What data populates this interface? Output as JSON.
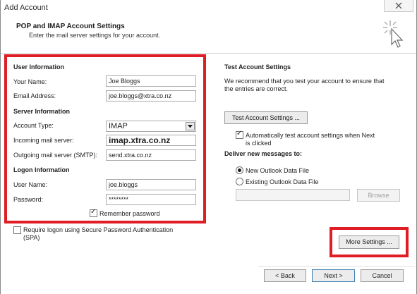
{
  "window": {
    "title": "Add Account"
  },
  "header": {
    "title": "POP and IMAP Account Settings",
    "subtitle": "Enter the mail server settings for your account."
  },
  "user_info": {
    "heading": "User Information",
    "name_label": "Your Name:",
    "name_value": "Joe Bloggs",
    "email_label": "Email Address:",
    "email_value": "joe.bloggs@xtra.co.nz"
  },
  "server_info": {
    "heading": "Server Information",
    "account_type_label": "Account Type:",
    "account_type_value": "IMAP",
    "incoming_label": "Incoming mail server:",
    "incoming_value": "imap.xtra.co.nz",
    "outgoing_label": "Outgoing mail server (SMTP):",
    "outgoing_value": "send.xtra.co.nz"
  },
  "logon_info": {
    "heading": "Logon Information",
    "user_label": "User Name:",
    "user_value": "joe.bloggs",
    "password_label": "Password:",
    "password_value": "********",
    "remember_label": "Remember password",
    "remember_checked": true,
    "spa_label_line1": "Require logon using Secure Password Authentication",
    "spa_label_line2": "(SPA)",
    "spa_checked": false
  },
  "test_settings": {
    "heading": "Test Account Settings",
    "desc_line1": "We recommend that you test your account to ensure that",
    "desc_line2": "the entries are correct.",
    "test_button": "Test Account Settings ...",
    "auto_test_line1": "Automatically test account settings when Next",
    "auto_test_line2": "is clicked",
    "auto_test_checked": true
  },
  "deliver": {
    "heading": "Deliver new messages to:",
    "option_new": "New Outlook Data File",
    "option_existing": "Existing Outlook Data File",
    "selected": "new",
    "existing_path": "",
    "browse_button": "Browse"
  },
  "buttons": {
    "more_settings": "More Settings ...",
    "back": "< Back",
    "next": "Next >",
    "cancel": "Cancel"
  },
  "colors": {
    "highlight": "#e01c24"
  }
}
